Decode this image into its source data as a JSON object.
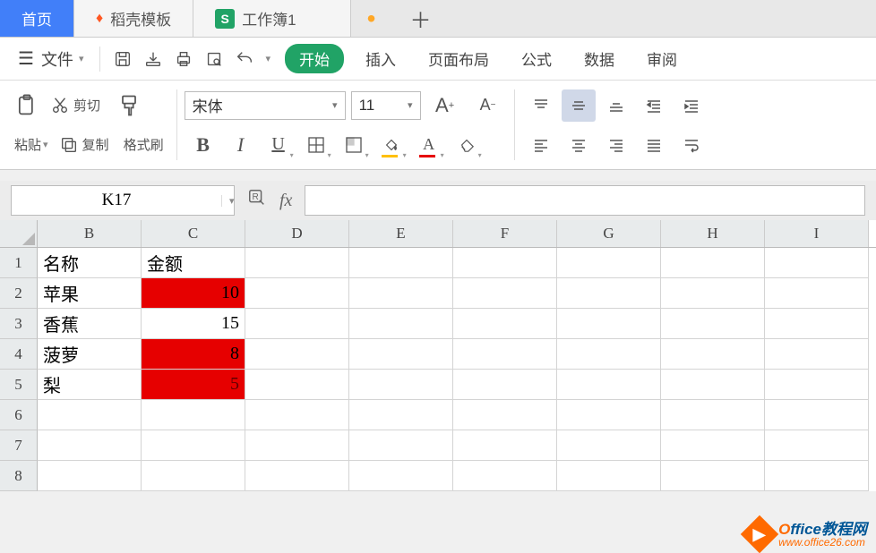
{
  "tabs": {
    "home": "首页",
    "docer": "稻壳模板",
    "workbook": "工作簿1"
  },
  "menu": {
    "file": "文件",
    "start": "开始",
    "insert": "插入",
    "page_layout": "页面布局",
    "formulas": "公式",
    "data": "数据",
    "review": "审阅"
  },
  "ribbon": {
    "paste": "粘贴",
    "cut": "剪切",
    "copy": "复制",
    "format_painter": "格式刷",
    "font_name": "宋体",
    "font_size": "11",
    "bold": "B",
    "italic": "I",
    "bigA": "A",
    "smallA": "A"
  },
  "refbar": {
    "name_box": "K17",
    "fx": "fx"
  },
  "sheet": {
    "columns": [
      "B",
      "C",
      "D",
      "E",
      "F",
      "G",
      "H",
      "I"
    ],
    "rows": [
      "1",
      "2",
      "3",
      "4",
      "5",
      "6",
      "7",
      "8"
    ],
    "data": {
      "B1": "名称",
      "C1": "金额",
      "B2": "苹果",
      "C2": "10",
      "B3": "香蕉",
      "C3": "15",
      "B4": "菠萝",
      "C4": "8",
      "B5": "梨",
      "C5": "5"
    }
  },
  "watermark": {
    "brand_prefix": "O",
    "brand_rest": "ffice教程网",
    "url": "www.office26.com"
  }
}
